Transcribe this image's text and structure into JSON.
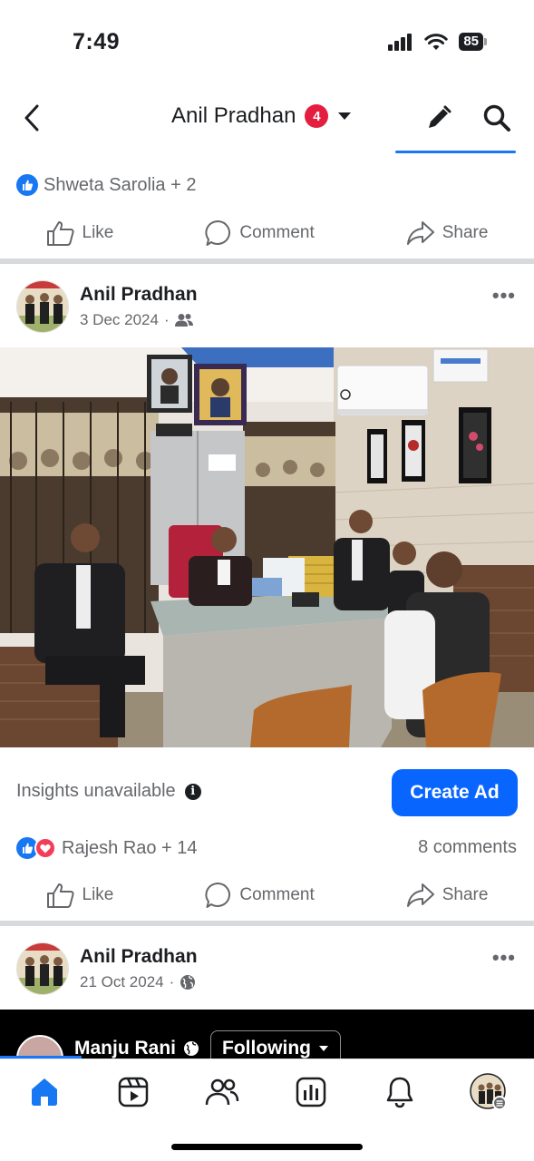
{
  "status_bar": {
    "time": "7:49",
    "battery": "85"
  },
  "header": {
    "title": "Anil Pradhan",
    "notification_count": "4"
  },
  "previous_post": {
    "reactors": "Shweta Sarolia + 2",
    "actions": {
      "like": "Like",
      "comment": "Comment",
      "share": "Share"
    }
  },
  "post": {
    "author": "Anil Pradhan",
    "date": "3 Dec 2024",
    "audience_icon": "friends-icon",
    "insights_text": "Insights unavailable",
    "create_ad_label": "Create Ad",
    "reactors": "Rajesh Rao + 14",
    "comments": "8 comments",
    "actions": {
      "like": "Like",
      "comment": "Comment",
      "share": "Share"
    }
  },
  "next_post": {
    "author": "Anil Pradhan",
    "date": "21 Oct 2024",
    "audience_icon": "globe-icon",
    "video": {
      "author": "Manju Rani",
      "follow_label": "Following"
    }
  },
  "tab_bar": {
    "items": [
      "home-icon",
      "reels-icon",
      "friends-icon",
      "dashboard-icon",
      "notifications-icon",
      "profile-icon"
    ],
    "active": "home-icon"
  },
  "colors": {
    "accent": "#1877f2",
    "create_ad": "#0866ff",
    "badge": "#e41e3f",
    "love": "#f33e58"
  }
}
